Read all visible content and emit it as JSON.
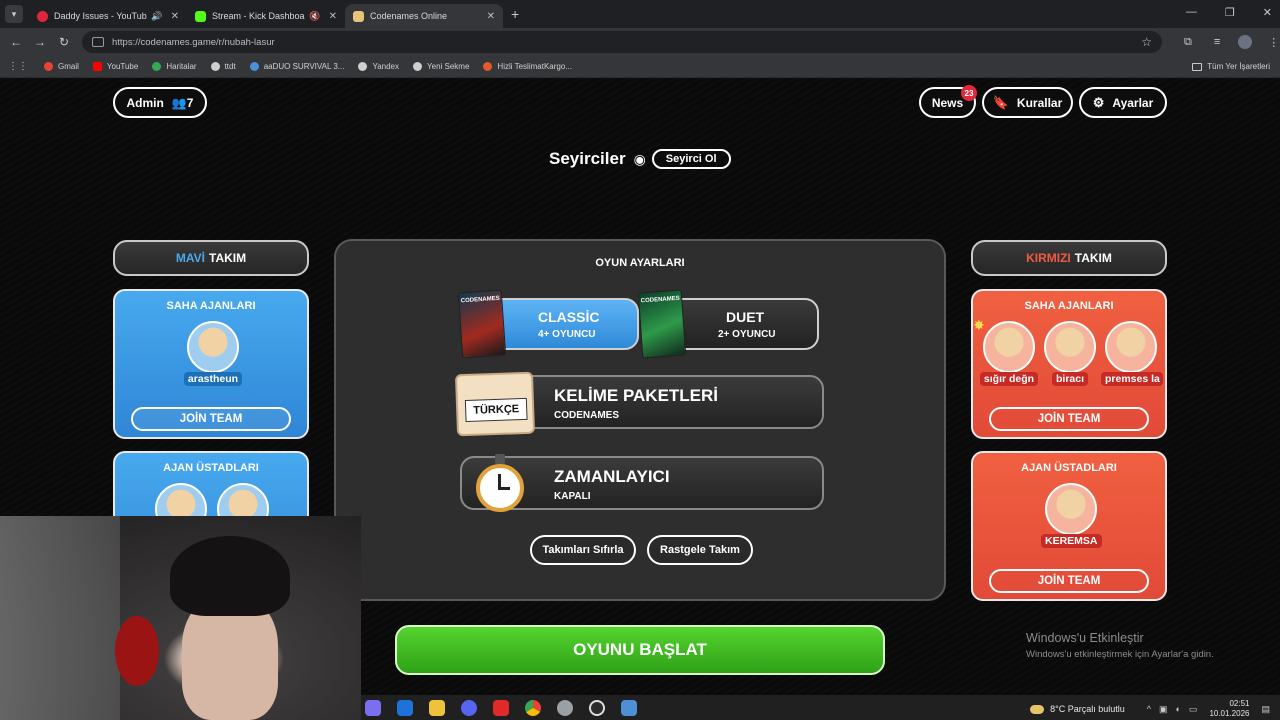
{
  "browser": {
    "tabs": [
      {
        "title": "Daddy Issues - YouTube Mu",
        "icon": "youtube-music-icon",
        "color": "#e0263b",
        "audio": true,
        "active": false
      },
      {
        "title": "Stream - Kick Dashboard",
        "icon": "kick-icon",
        "color": "#53fc18",
        "audio": true,
        "active": false
      },
      {
        "title": "Codenames Online",
        "icon": "codenames-icon",
        "color": "#e8c47a",
        "audio": false,
        "active": true
      }
    ],
    "url": "https://codenames.game/r/nubah-lasur",
    "bookmarks": [
      {
        "label": "Gmail",
        "color": "#ea4335"
      },
      {
        "label": "YouTube",
        "color": "#ff0000"
      },
      {
        "label": "Haritalar",
        "color": "#34a853"
      },
      {
        "label": "ttdt",
        "color": "#cfcfcf"
      },
      {
        "label": "aaDUO SURVIVAL 3...",
        "color": "#4a90d9"
      },
      {
        "label": "Yandex",
        "color": "#cfcfcf"
      },
      {
        "label": "Yeni Sekme",
        "color": "#cfcfcf"
      },
      {
        "label": "Hizli TeslimatKargo...",
        "color": "#e35b2b"
      }
    ],
    "all_bookmarks": "Tüm Yer İşaretleri"
  },
  "header": {
    "admin_label": "Admin",
    "player_count": "7",
    "news_label": "News",
    "news_badge": "23",
    "rules_label": "Kurallar",
    "settings_label": "Ayarlar"
  },
  "spectators": {
    "label": "Seyirciler",
    "button": "Seyirci Ol"
  },
  "blue_team": {
    "color_word": "MAVİ",
    "word": "TAKIM",
    "operatives_title": "SAHA AJANLARI",
    "operatives": [
      "arastheun"
    ],
    "join_label": "JOİN TEAM",
    "spymasters_title": "AJAN ÜSTADLARI"
  },
  "red_team": {
    "color_word": "KIRMIZI",
    "word": "TAKIM",
    "operatives_title": "SAHA AJANLARI",
    "operatives": [
      "sığır değn",
      "biracı",
      "premses la"
    ],
    "join_label": "JOİN TEAM",
    "spymasters_title": "AJAN ÜSTADLARI",
    "spymasters": [
      "KEREMSA"
    ],
    "join_label_2": "JOİN TEAM"
  },
  "game_settings": {
    "title": "OYUN AYARLARI",
    "classic": {
      "name": "CLASSİC",
      "players": "4+ OYUNCU",
      "box": "CODENAMES"
    },
    "duet": {
      "name": "DUET",
      "players": "2+ OYUNCU",
      "box": "CODENAMES"
    },
    "word_packs": {
      "title": "KELİME PAKETLERİ",
      "sub": "CODENAMES",
      "language": "TÜRKÇE"
    },
    "timer": {
      "title": "ZAMANLAYICI",
      "sub": "KAPALI"
    },
    "reset_label": "Takımları Sıfırla",
    "random_label": "Rastgele Takım"
  },
  "start_label": "OYUNU BAŞLAT",
  "windows_activation": {
    "line1": "Windows'u Etkinleştir",
    "line2": "Windows'u etkinleştirmek için Ayarlar'a gidin."
  },
  "taskbar": {
    "apps": [
      {
        "name": "copilot-icon",
        "color": "#7a6ff0"
      },
      {
        "name": "outlook-icon",
        "color": "#1e73d8"
      },
      {
        "name": "file-explorer-icon",
        "color": "#f0c23a"
      },
      {
        "name": "discord-icon",
        "color": "#5865f2"
      },
      {
        "name": "wps-icon",
        "color": "#e02a2a"
      },
      {
        "name": "chrome-icon",
        "color": "#34a853"
      },
      {
        "name": "chrome-active-icon",
        "color": "#9aa0a6"
      },
      {
        "name": "obs-icon",
        "color": "#2b2b2b"
      },
      {
        "name": "app-icon",
        "color": "#4f8fd6"
      }
    ],
    "weather": "8°C  Parçalı bulutlu",
    "time": "02:51",
    "date": "10.01.2026"
  }
}
